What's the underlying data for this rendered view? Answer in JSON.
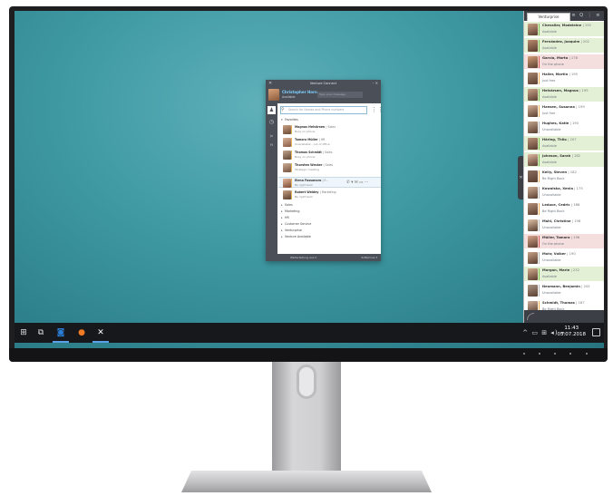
{
  "popup": {
    "title": "Venture Connect",
    "user_name": "Christopher Horn",
    "user_status": "Available",
    "message_placeholder": "Type your message",
    "search_placeholder": "Search for Names and Phone numbers",
    "sidebar_labels": [
      "Jn",
      "Ft"
    ],
    "groups": {
      "favorites": "Favorites",
      "sales": "Sales",
      "marketing": "Marketing",
      "hr": "HR",
      "customer_service": "Customer Service",
      "venturprise": "Venturprise",
      "available": "Venture Available"
    },
    "contacts": [
      {
        "name": "Magnus Helvärsen",
        "dept": "| Sales",
        "status": "Busy on phone",
        "color": "#e8b65a"
      },
      {
        "name": "Tamara Müller",
        "dept": "| HR",
        "status": "Unavailable - out of office",
        "color": "#e8b65a"
      },
      {
        "name": "Thomas Schmidt",
        "dept": "| Sales",
        "status": "Busy on phone",
        "color": "#e8b65a"
      },
      {
        "name": "Thorsten Wecker",
        "dept": "| Sales",
        "status": "Strategic meeting",
        "color": "#e8b65a"
      },
      {
        "name": "Elena Fossanaro",
        "dept": "| F...",
        "status": "Be right back",
        "color": "#e8b65a"
      },
      {
        "name": "Robert Weidey",
        "dept": "| Marketing",
        "status": "Be right back",
        "color": "#e8b65a"
      }
    ],
    "footer_left": "Weiterleitung aus ▾",
    "footer_right": "Softphone ▾"
  },
  "panel": {
    "tab": "Venturprise",
    "icons": "≡ Q ⋮ ≡",
    "people": [
      {
        "name": "Chevalier, Madeleine",
        "ext": "| 192",
        "status": "Available",
        "tint": "#e3f0d6",
        "bar": "#7cbf4a"
      },
      {
        "name": "Fernández, Joaquim",
        "ext": "| 202",
        "status": "Available",
        "tint": "#e3f0d6",
        "bar": "#7cbf4a"
      },
      {
        "name": "García, Marta",
        "ext": "| 178",
        "status": "On the phone",
        "tint": "#f5dede",
        "bar": "#d9534f"
      },
      {
        "name": "Haller, Martin",
        "ext": "| 195",
        "status": "Just free",
        "tint": "#ffffff",
        "bar": "#f0ad4e"
      },
      {
        "name": "Helvärsen, Magnus",
        "ext": "| 195",
        "status": "Available",
        "tint": "#e3f0d6",
        "bar": "#7cbf4a"
      },
      {
        "name": "Hansen, Susanna",
        "ext": "| 199",
        "status": "Just free",
        "tint": "#ffffff",
        "bar": "#f0ad4e"
      },
      {
        "name": "Hughes, Katie",
        "ext": "| 190",
        "status": "Unavailable",
        "tint": "#ffffff",
        "bar": "#bbbbbb"
      },
      {
        "name": "Häring, Thilo",
        "ext": "| 207",
        "status": "Available",
        "tint": "#e3f0d6",
        "bar": "#7cbf4a"
      },
      {
        "name": "Johnson, Sarah",
        "ext": "| 182",
        "status": "Available",
        "tint": "#e3f0d6",
        "bar": "#7cbf4a"
      },
      {
        "name": "Kelly, Steven",
        "ext": "| 182",
        "status": "Be Right Back",
        "tint": "#ffffff",
        "bar": "#f0ad4e"
      },
      {
        "name": "Kowalska, Xenia",
        "ext": "| 175",
        "status": "Unavailable",
        "tint": "#ffffff",
        "bar": "#bbbbbb"
      },
      {
        "name": "Leduce, Cedric",
        "ext": "| 188",
        "status": "Be Right Back",
        "tint": "#ffffff",
        "bar": "#f0ad4e"
      },
      {
        "name": "Mahl, Christine",
        "ext": "| 198",
        "status": "Unavailable",
        "tint": "#ffffff",
        "bar": "#bbbbbb"
      },
      {
        "name": "Müller, Tamara",
        "ext": "| 196",
        "status": "On the phone",
        "tint": "#f5dede",
        "bar": "#d9534f"
      },
      {
        "name": "Mohr, Volker",
        "ext": "| 190",
        "status": "Unavailable",
        "tint": "#ffffff",
        "bar": "#bbbbbb"
      },
      {
        "name": "Morgan, Marie",
        "ext": "| 232",
        "status": "Available",
        "tint": "#e3f0d6",
        "bar": "#7cbf4a"
      },
      {
        "name": "Neumann, Benjamin",
        "ext": "| 205",
        "status": "Unavailable",
        "tint": "#ffffff",
        "bar": "#bbbbbb"
      },
      {
        "name": "Schmidt, Thomas",
        "ext": "| 187",
        "status": "Be Right Back",
        "tint": "#ffffff",
        "bar": "#f0ad4e"
      }
    ]
  },
  "taskbar": {
    "time": "11:43",
    "date": "05.07.2018",
    "tray": "^ ▭ ⊞ ◂) ⌁"
  }
}
